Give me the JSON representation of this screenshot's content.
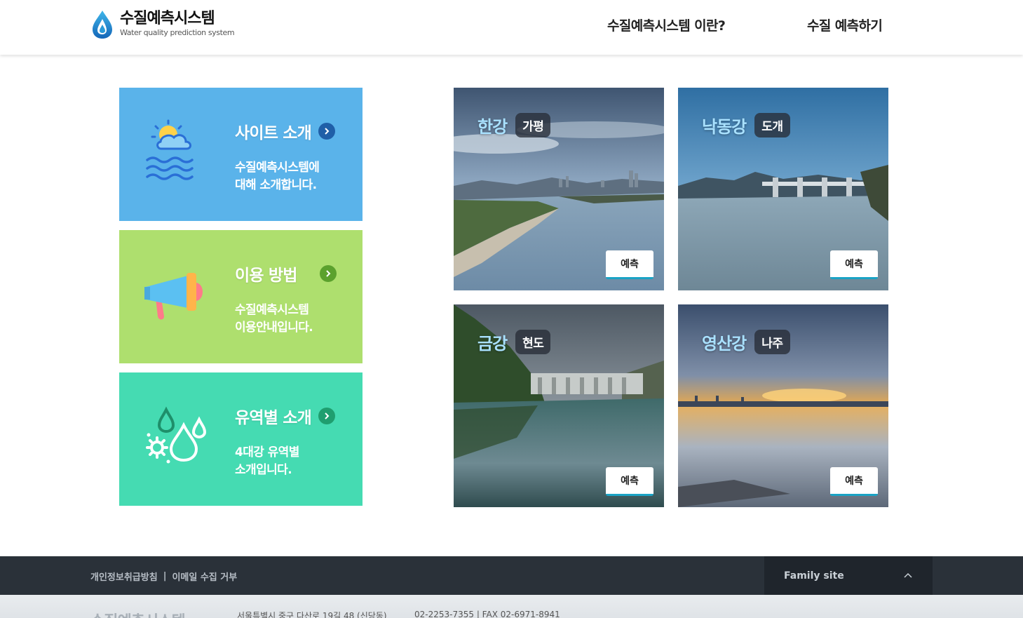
{
  "header": {
    "logo_title": "수질예측시스템",
    "logo_subtitle": "Water quality prediction system",
    "nav": [
      {
        "label": "수질예측시스템 이란?"
      },
      {
        "label": "수질 예측하기"
      }
    ]
  },
  "intro_cards": [
    {
      "title": "사이트 소개",
      "desc": "수질예측시스템에\n대해 소개합니다.",
      "icon": "weather-water-icon",
      "color": "#5ab3ea"
    },
    {
      "title": "이용 방법",
      "desc": "수질예측시스템\n이용안내입니다.",
      "icon": "megaphone-icon",
      "color": "#aedf6e"
    },
    {
      "title": "유역별 소개",
      "desc": "4대강 유역별\n소개입니다.",
      "icon": "water-drops-icon",
      "color": "#45dbb2"
    }
  ],
  "rivers": [
    {
      "name": "한강",
      "site": "가평",
      "button": "예측"
    },
    {
      "name": "낙동강",
      "site": "도개",
      "button": "예측"
    },
    {
      "name": "금강",
      "site": "현도",
      "button": "예측"
    },
    {
      "name": "영산강",
      "site": "나주",
      "button": "예측"
    }
  ],
  "footer": {
    "links": [
      "개인정보취급방침",
      "이메일 수집 거부"
    ],
    "separator": "|",
    "family_site": "Family site",
    "logo_text": "수질예측시스템",
    "address": "서울특별시 중구 다산로 19길 48 (신당동)",
    "phone": "02-2253-7355 | FAX 02-6971-8941"
  },
  "colors": {
    "accent": "#1aa3c5",
    "footer_dark": "#2a3139",
    "river_name": "#a9e1ff"
  }
}
